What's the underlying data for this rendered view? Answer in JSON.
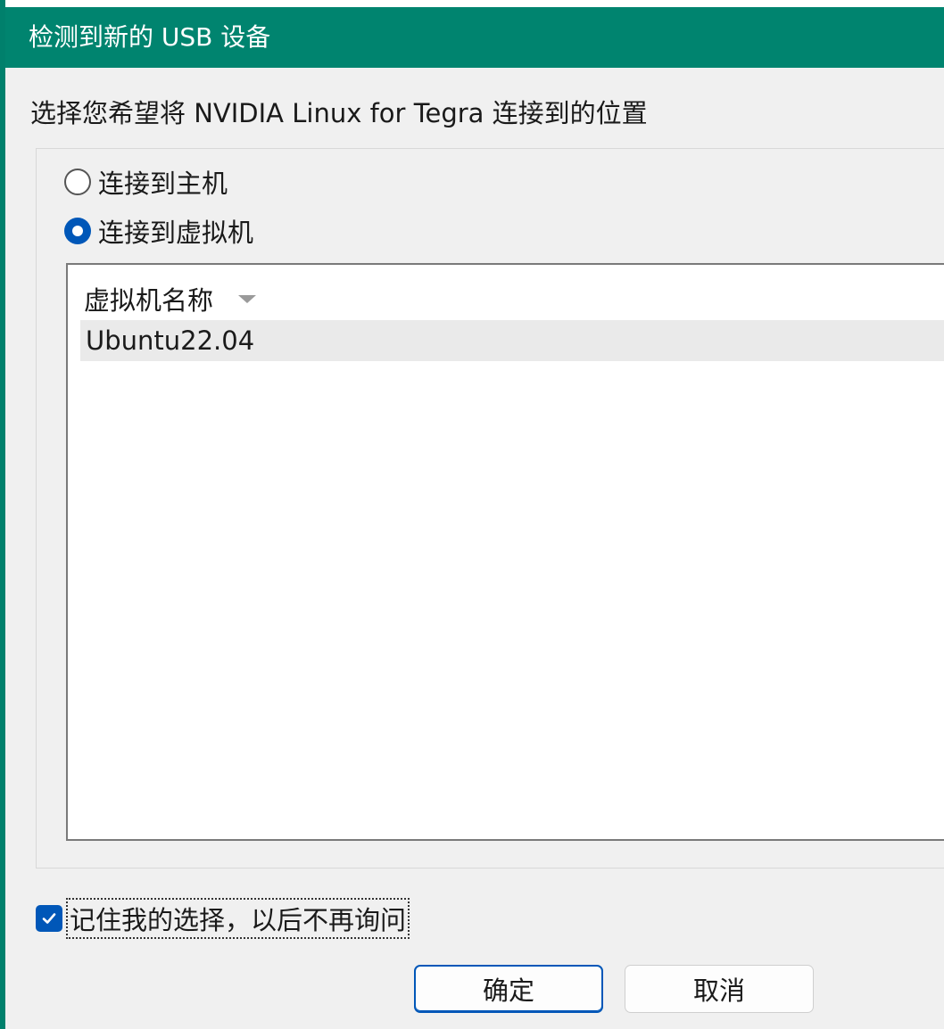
{
  "window": {
    "title": "检测到新的 USB 设备"
  },
  "prompt": "选择您希望将 NVIDIA Linux for Tegra 连接到的位置",
  "options": {
    "host_label": "连接到主机",
    "vm_label": "连接到虚拟机",
    "selected": "vm"
  },
  "vm_list": {
    "column_header": "虚拟机名称",
    "rows": [
      "Ubuntu22.04"
    ]
  },
  "remember": {
    "label": "记住我的选择，以后不再询问",
    "checked": true
  },
  "buttons": {
    "ok": "确定",
    "cancel": "取消"
  },
  "colors": {
    "titlebar": "#00846f",
    "accent": "#0057b8"
  }
}
